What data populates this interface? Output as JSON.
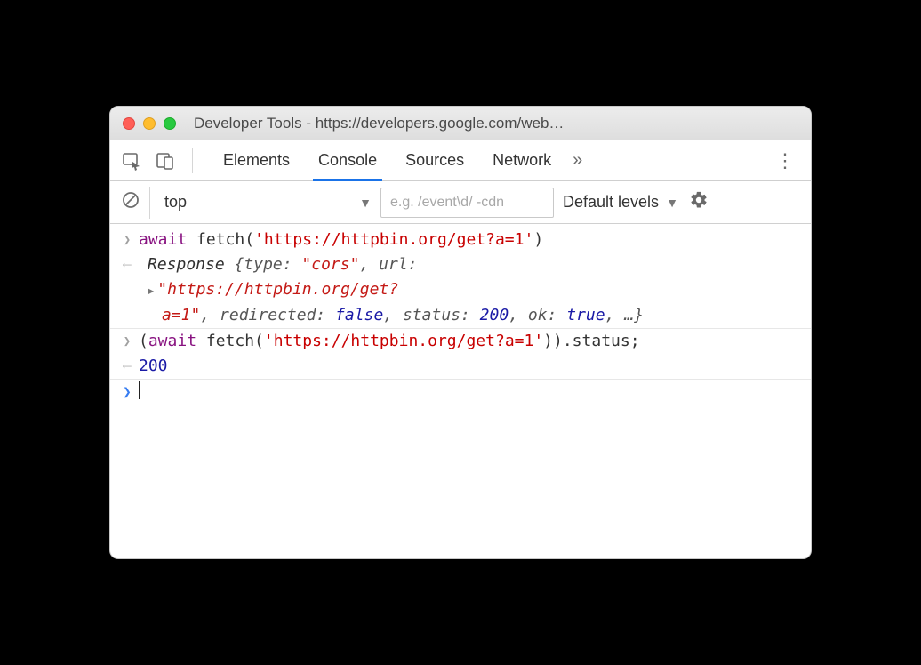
{
  "window": {
    "title": "Developer Tools - https://developers.google.com/web…"
  },
  "tabs": {
    "elements": "Elements",
    "console": "Console",
    "sources": "Sources",
    "network": "Network"
  },
  "filter": {
    "context": "top",
    "placeholder": "e.g. /event\\d/ -cdn",
    "levels": "Default levels"
  },
  "console": {
    "line1": {
      "await": "await",
      "fetchStart": " fetch(",
      "url": "'https://httpbin.org/get?a=1'",
      "fetchEnd": ")"
    },
    "resp": {
      "responseWord": "Response ",
      "open": "{",
      "type_k": "type: ",
      "type_v": "\"cors\"",
      "c1": ", ",
      "url_k": "url:",
      "url_v1": "\"https://httpbin.org/get?",
      "url_v2": "a=1\"",
      "c2": ", ",
      "redirected_k": "redirected: ",
      "redirected_v": "false",
      "c3": ", ",
      "status_k": "status: ",
      "status_v": "200",
      "c4": ", ",
      "ok_k": "ok: ",
      "ok_v": "true",
      "c5": ", …}"
    },
    "line2": {
      "pre": "(",
      "await": "await",
      "fetchStart": " fetch(",
      "url": "'https://httpbin.org/get?a=1'",
      "fetchEnd": ")).status;"
    },
    "line2_result": "200"
  }
}
